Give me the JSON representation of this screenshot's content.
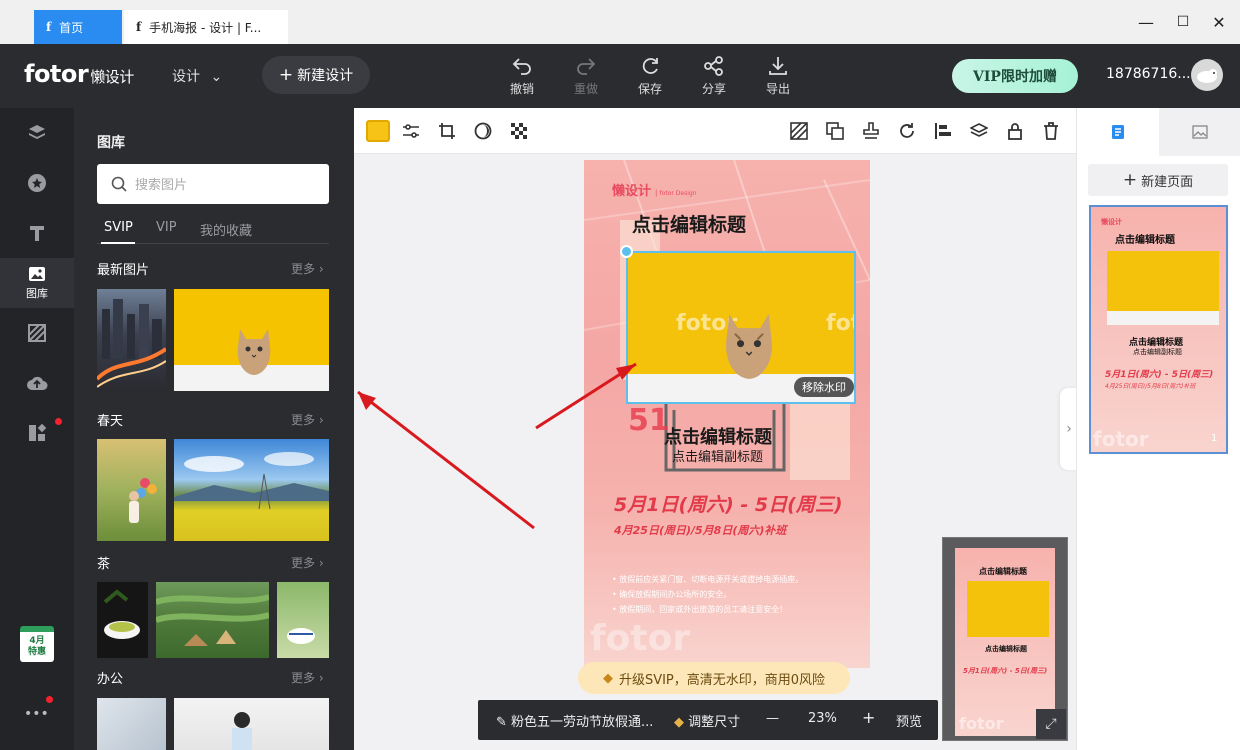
{
  "tabs": [
    {
      "label": "首页"
    },
    {
      "label": "手机海报 - 设计 | F..."
    }
  ],
  "window_controls": {
    "minimize": "—",
    "maximize": "☐",
    "close": "✕"
  },
  "topbar": {
    "logo": "fotor",
    "logo_sub": "懒设计",
    "design_menu": "设计",
    "new_design": "新建设计",
    "tools": [
      {
        "label": "撤销",
        "icon": "undo-icon"
      },
      {
        "label": "重做",
        "icon": "redo-icon"
      },
      {
        "label": "保存",
        "icon": "save-icon"
      },
      {
        "label": "分享",
        "icon": "share-icon"
      },
      {
        "label": "导出",
        "icon": "export-icon"
      }
    ],
    "vip": "VIP限时加赠",
    "username": "18786716..."
  },
  "rail": {
    "items": [
      {
        "icon": "layers-icon"
      },
      {
        "icon": "star-icon"
      },
      {
        "icon": "text-icon"
      },
      {
        "icon": "image-library-icon",
        "label": "图库"
      },
      {
        "icon": "texture-icon"
      },
      {
        "icon": "upload-cloud-icon"
      },
      {
        "icon": "apps-icon"
      }
    ],
    "promo": {
      "month": "4月",
      "label": "特惠"
    },
    "more": "•••"
  },
  "panel": {
    "title": "图库",
    "search_placeholder": "搜索图片",
    "tabs": [
      "SVIP",
      "VIP",
      "我的收藏"
    ],
    "more_label": "更多",
    "sections": [
      {
        "title": "最新图片"
      },
      {
        "title": "春天"
      },
      {
        "title": "茶"
      },
      {
        "title": "办公"
      }
    ]
  },
  "poster": {
    "brand": "懒设计",
    "brand_sub": "fotor Design",
    "title": "点击编辑标题",
    "title2": "点击编辑标题",
    "subtitle": "点击编辑副标题",
    "watermark": "fotor",
    "date_main": "5月1日(周六) - 5日(周三)",
    "date_sub": "4月25日(周日)/5月8日(周六)补班",
    "notes": [
      "• 放假前应关紧门窗、切断电源开关或拔掉电源插座。",
      "• 确保放假期间办公场所的安全。",
      "• 放假期间，回家或外出旅游的员工请注意安全！"
    ],
    "remove_watermark": "移除水印"
  },
  "bottombar": {
    "upgrade": "升级SVIP，高清无水印，商用0风险",
    "doc_name": "粉色五一劳动节放假通...",
    "resize": "调整尺寸",
    "minus": "—",
    "zoom": "23%",
    "plus": "+",
    "preview": "预览"
  },
  "right_panel": {
    "new_page": "新建页面",
    "page_number": "1"
  },
  "colors": {
    "accent": "#2a8cf0",
    "swatch": "#f7c316",
    "selection": "#5bc0eb"
  }
}
